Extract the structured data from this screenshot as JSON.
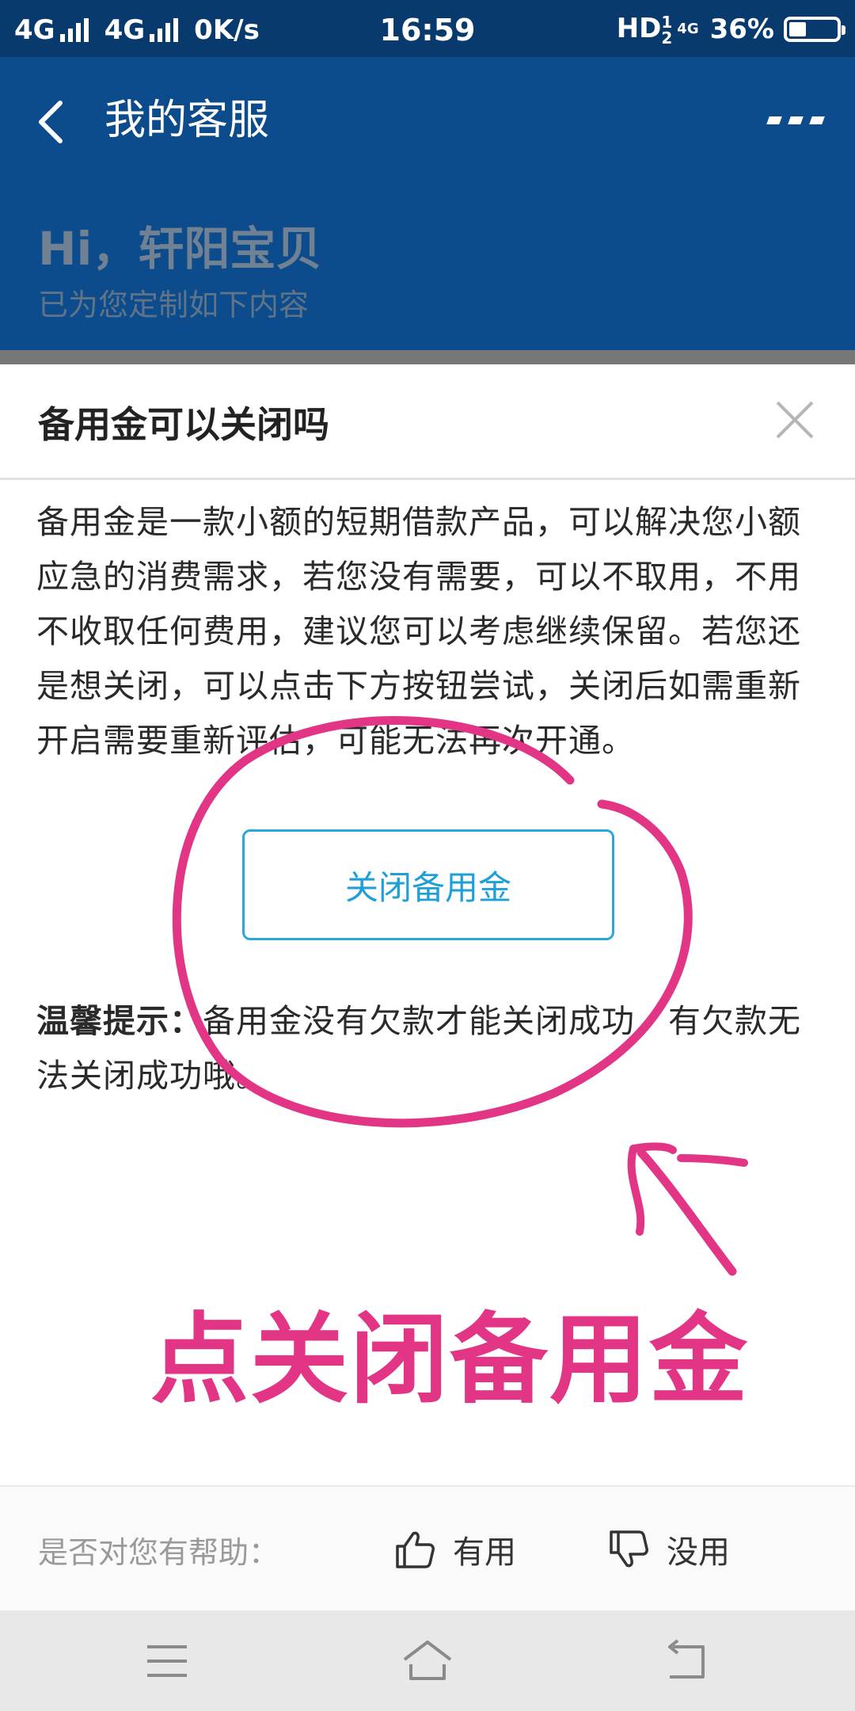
{
  "status_bar": {
    "network1": "4G",
    "network2": "4G",
    "speed": "0K/s",
    "time": "16:59",
    "hd": "HD",
    "hd_sup": "1",
    "hd_sub": "2",
    "net_small": "4G",
    "battery": "36%",
    "battery_level": 0.36
  },
  "header": {
    "title": "我的客服",
    "greeting": "Hi，轩阳宝贝",
    "subtitle": "已为您定制如下内容"
  },
  "card": {
    "title": "备用金可以关闭吗",
    "body": "备用金是一款小额的短期借款产品，可以解决您小额应急的消费需求，若您没有需要，可以不取用，不用不收取任何费用，建议您可以考虑继续保留。若您还是想关闭，可以点击下方按钮尝试，关闭后如需重新开启需要重新评估，可能无法再次开通。",
    "button_label": "关闭备用金",
    "tip_label": "温馨提示：",
    "tip_text": "备用金没有欠款才能关闭成功，有欠款无法关闭成功哦。"
  },
  "annotation": {
    "text": "点关闭备用金",
    "color": "#e23585"
  },
  "feedback": {
    "question": "是否对您有帮助：",
    "useful": "有用",
    "useless": "没用"
  },
  "colors": {
    "header_bg": "#0d4c8c",
    "status_bg": "#083a6e",
    "accent": "#1e9fd8"
  }
}
